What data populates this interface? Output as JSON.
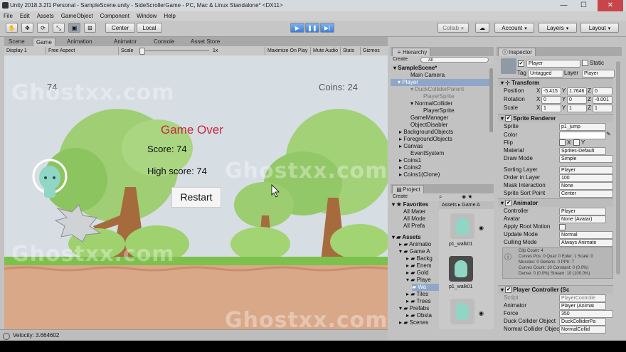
{
  "window": {
    "title": "Unity 2018.3.2f1 Personal - SampleScene.unity - SideScrollerGame - PC, Mac & Linux Standalone* <DX11>",
    "minimize": "—",
    "maximize": "☐",
    "close": "✕"
  },
  "menu": [
    "File",
    "Edit",
    "Assets",
    "GameObject",
    "Component",
    "Window",
    "Help"
  ],
  "toolbar": {
    "center": "Center",
    "local": "Local",
    "collab": "Collab",
    "account": "Account",
    "layers": "Layers",
    "layout": "Layout",
    "play": "▶",
    "pause": "❚❚",
    "step": "▶|"
  },
  "tabs": {
    "scene": "Scene",
    "game": "Game",
    "animation": "Animation",
    "animator": "Animator",
    "console": "Console",
    "asset_store": "Asset Store",
    "hierarchy": "Hierarchy",
    "project": "Project",
    "inspector": "Inspector"
  },
  "game_view": {
    "display": "Display 1",
    "aspect": "Free Aspect",
    "scale_label": "Scale",
    "scale_value": "1x",
    "maximize": "Maximize On Play",
    "mute": "Mute Audio",
    "stats": "Stats",
    "gizmos": "Gizmos"
  },
  "hud": {
    "lives": "74",
    "coins": "Coins: 24",
    "game_over": "Game Over",
    "score": "Score: 74",
    "high_score": "High score: 74",
    "restart": "Restart"
  },
  "status": {
    "velocity": "Velocity: 3.664602"
  },
  "hierarchy": {
    "create": "Create",
    "search": "All",
    "scene": "SampleScene*",
    "items": [
      "Main Camera",
      "Player",
      "DuckColliderParent",
      "PlayerSprite",
      "NormalCollider",
      "PlayerSprite",
      "GameManager",
      "ObjectDisabler",
      "BackgroundObjects",
      "ForegroundObjects",
      "Canvas",
      "EventSystem",
      "Coins1",
      "Coins2",
      "Coins1(Clone)"
    ]
  },
  "project": {
    "create": "Create",
    "favorites": "Favorites",
    "fav_items": [
      "All Mater",
      "All Mode",
      "All Prefa"
    ],
    "assets_label": "Assets",
    "tree": [
      "Animatio",
      "Game A",
      "Backg",
      "Enem",
      "Gold",
      "Playe",
      "Wa",
      "Tiles",
      "Trees",
      "Prefabs",
      "Obsta",
      "Scenes"
    ],
    "breadcrumb": [
      "Assets",
      "Game A"
    ],
    "thumbs": [
      "p1_walk01",
      "p1_walk01",
      ""
    ]
  },
  "inspector": {
    "object_name": "Player",
    "static": "Static",
    "tag_label": "Tag",
    "tag": "Untagged",
    "layer_label": "Layer",
    "layer": "Player",
    "transform": {
      "header": "Transform",
      "position": "Position",
      "rotation": "Rotation",
      "scale": "Scale",
      "px": "-5.415",
      "py": "1.7646",
      "pz": "0",
      "rx": "0",
      "ry": "0",
      "rz": "-0.001",
      "sx": "1",
      "sy": "1",
      "sz": "1",
      "x": "X",
      "y": "Y",
      "z": "Z"
    },
    "sprite_renderer": {
      "header": "Sprite Renderer",
      "sprite_label": "Sprite",
      "sprite": "p1_jump",
      "color_label": "Color",
      "flip_label": "Flip",
      "flip_x": "X",
      "flip_y": "Y",
      "material_label": "Material",
      "material": "Sprites-Default",
      "draw_mode_label": "Draw Mode",
      "draw_mode": "Simple",
      "sorting_layer_label": "Sorting Layer",
      "sorting_layer": "Player",
      "order_label": "Order in Layer",
      "order": "100",
      "mask_label": "Mask Interaction",
      "mask": "None",
      "sort_point_label": "Sprite Sort Point",
      "sort_point": "Center"
    },
    "animator": {
      "header": "Animator",
      "controller_label": "Controller",
      "controller": "Player",
      "avatar_label": "Avatar",
      "avatar": "None (Avatar)",
      "root_motion_label": "Apply Root Motion",
      "update_mode_label": "Update Mode",
      "update_mode": "Normal",
      "culling_label": "Culling Mode",
      "culling": "Always Animate",
      "info": [
        "Clip Count: 4",
        "Curves Pos: 0 Quat: 0 Euler: 1 Scale: 0",
        "Muscles: 0 Generic: 0 PPtr: 7",
        "Curves Count: 10 Constant: 0 (0.0%)",
        "Dense: 0 (0.0%) Stream: 10 (100.0%)"
      ]
    },
    "player_controller": {
      "header": "Player Controller (Sc",
      "script_label": "Script",
      "script": "PlayerControlle",
      "animator_label": "Animator",
      "animator": "Player (Animat",
      "force_label": "Force",
      "force": "350",
      "duck_label": "Duck Collider Object",
      "duck": "DuckColliderPa",
      "normal_label": "Normal Collider Object",
      "normal": "NormalCollid"
    }
  },
  "watermark": "Ghostxx.com",
  "colors": {
    "game_over": "#c9283b",
    "accent_blue": "#3d7ed8",
    "selection": "#8fa6c9"
  }
}
